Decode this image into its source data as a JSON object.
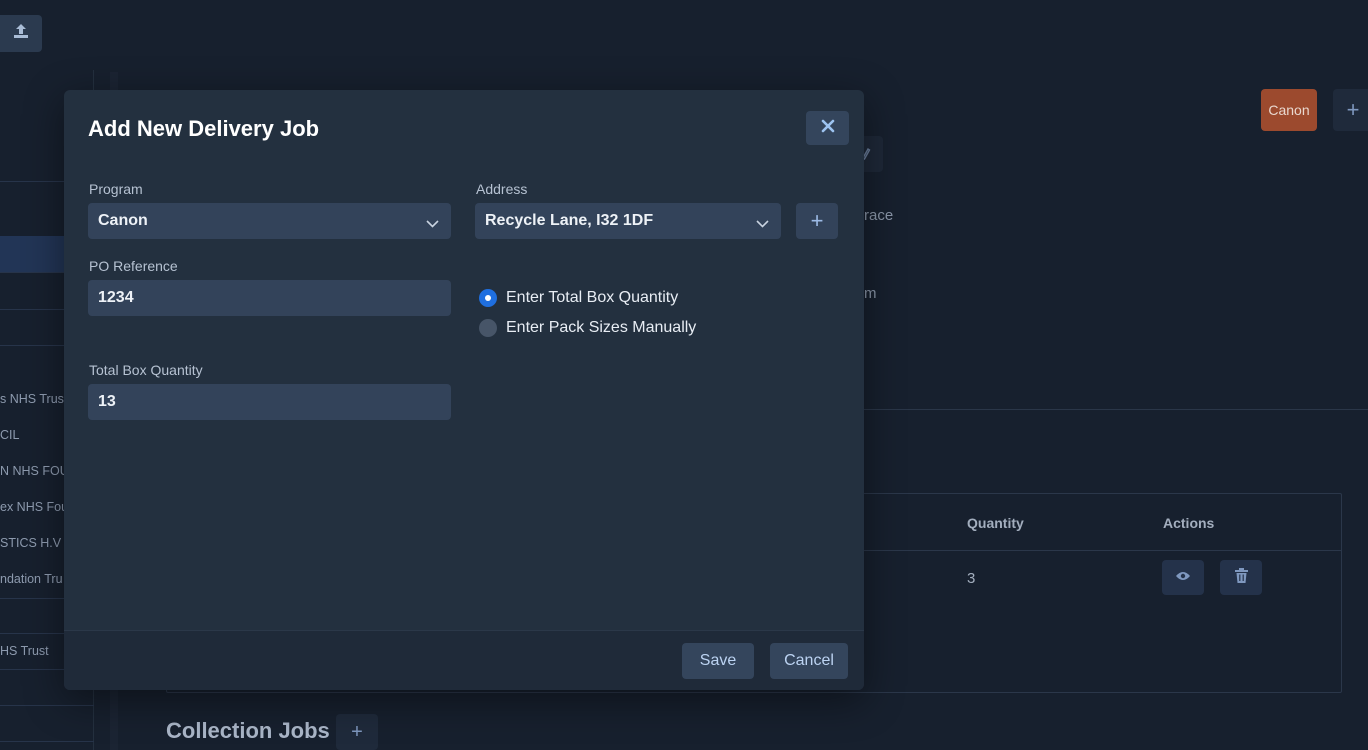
{
  "background": {
    "sidebar_items": [
      "s NHS Trust",
      "CIL",
      "N NHS FOUN",
      "ex NHS Fou",
      "STICS H.V",
      "ndation Tru",
      "HS Trust"
    ],
    "program_tag": "Canon",
    "plus_label": "+",
    "partial_text_1": "race",
    "partial_text_2": "m",
    "table": {
      "columns": [
        "Quantity",
        "Actions"
      ],
      "rows": [
        {
          "quantity": "3"
        }
      ]
    },
    "collection_heading": "Collection Jobs"
  },
  "modal": {
    "title": "Add New Delivery Job",
    "program": {
      "label": "Program",
      "value": "Canon"
    },
    "address": {
      "label": "Address",
      "value": "Recycle Lane, I32 1DF"
    },
    "add_address_label": "+",
    "po_reference": {
      "label": "PO Reference",
      "value": "1234"
    },
    "quantity_mode": {
      "options": [
        "Enter Total Box Quantity",
        "Enter Pack Sizes Manually"
      ],
      "selected": "Enter Total Box Quantity"
    },
    "total_box_quantity": {
      "label": "Total Box Quantity",
      "value": "13"
    },
    "buttons": {
      "save": "Save",
      "cancel": "Cancel"
    }
  },
  "colors": {
    "page_bg": "#17202e",
    "modal_bg": "#23303f",
    "field_bg": "#33435a",
    "radio_selected": "#1f6fe0",
    "tag_orange": "#9c4a2e"
  }
}
